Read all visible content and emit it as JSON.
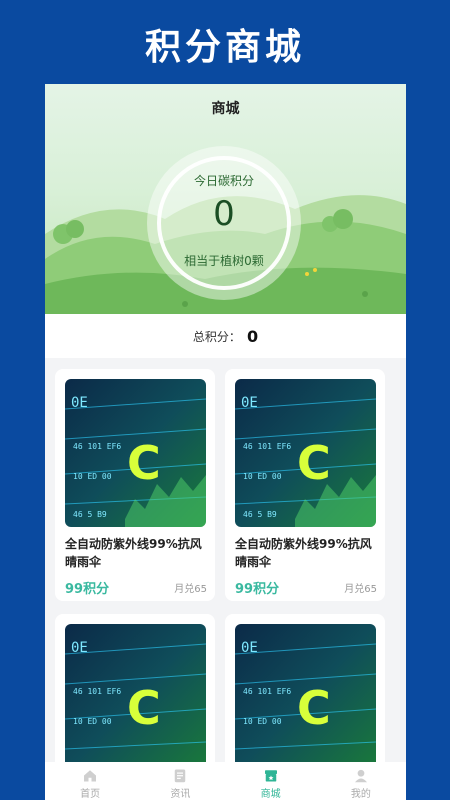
{
  "banner": {
    "title": "积分商城"
  },
  "header": {
    "title": "商城"
  },
  "carbon": {
    "today_label": "今日碳积分",
    "today_value": "0",
    "equivalent_text": "相当于植树0颗"
  },
  "total": {
    "label": "总积分：",
    "value": "0"
  },
  "products": [
    {
      "name": "全自动防紫外线99%抗风晴雨伞",
      "points": "99积分",
      "sold": "月兑65"
    },
    {
      "name": "全自动防紫外线99%抗风晴雨伞",
      "points": "99积分",
      "sold": "月兑65"
    },
    {
      "name": "",
      "points": "",
      "sold": ""
    },
    {
      "name": "",
      "points": "",
      "sold": ""
    }
  ],
  "tabs": [
    {
      "icon": "home-icon",
      "label": "首页"
    },
    {
      "icon": "news-icon",
      "label": "资讯"
    },
    {
      "icon": "store-icon",
      "label": "商城",
      "active": true
    },
    {
      "icon": "profile-icon",
      "label": "我的"
    }
  ],
  "colors": {
    "banner_bg": "#0a4aa0",
    "accent": "#3ab9a0",
    "active_tab": "#2fb596"
  }
}
